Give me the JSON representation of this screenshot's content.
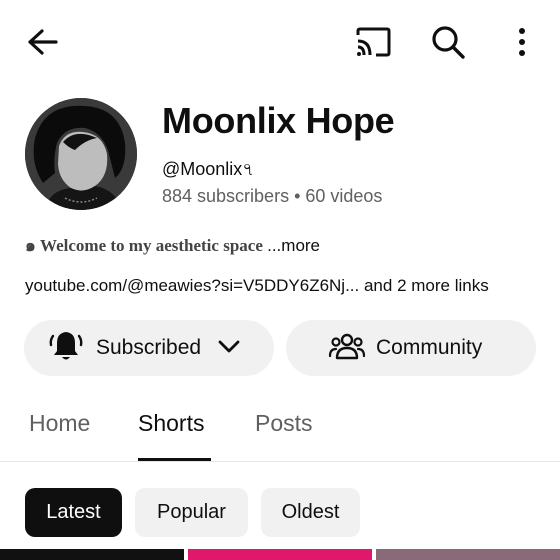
{
  "topbar": {
    "icons": [
      "back-arrow-icon",
      "cast-icon",
      "search-icon",
      "more-vert-icon"
    ]
  },
  "channel": {
    "name": "Moonlix Hope",
    "handle": "@Moonlix৭",
    "stats": "884 subscribers • 60 videos",
    "description": "๑ Welcome to my aesthetic space ",
    "description_more": "...more",
    "links": "youtube.com/@meawies?si=V5DDY6Z6Nj... and 2 more links"
  },
  "actions": {
    "subscribed_label": "Subscribed",
    "community_label": "Community"
  },
  "tabs": [
    {
      "label": "Home",
      "active": false
    },
    {
      "label": "Shorts",
      "active": true
    },
    {
      "label": "Posts",
      "active": false
    }
  ],
  "filters": [
    {
      "label": "Latest",
      "active": true
    },
    {
      "label": "Popular",
      "active": false
    },
    {
      "label": "Oldest",
      "active": false
    }
  ],
  "colors": {
    "text": "#0f0f0f",
    "secondary_text": "#606060",
    "chip_bg": "#f1f1f1",
    "thumb_pink": "#e0186c"
  }
}
